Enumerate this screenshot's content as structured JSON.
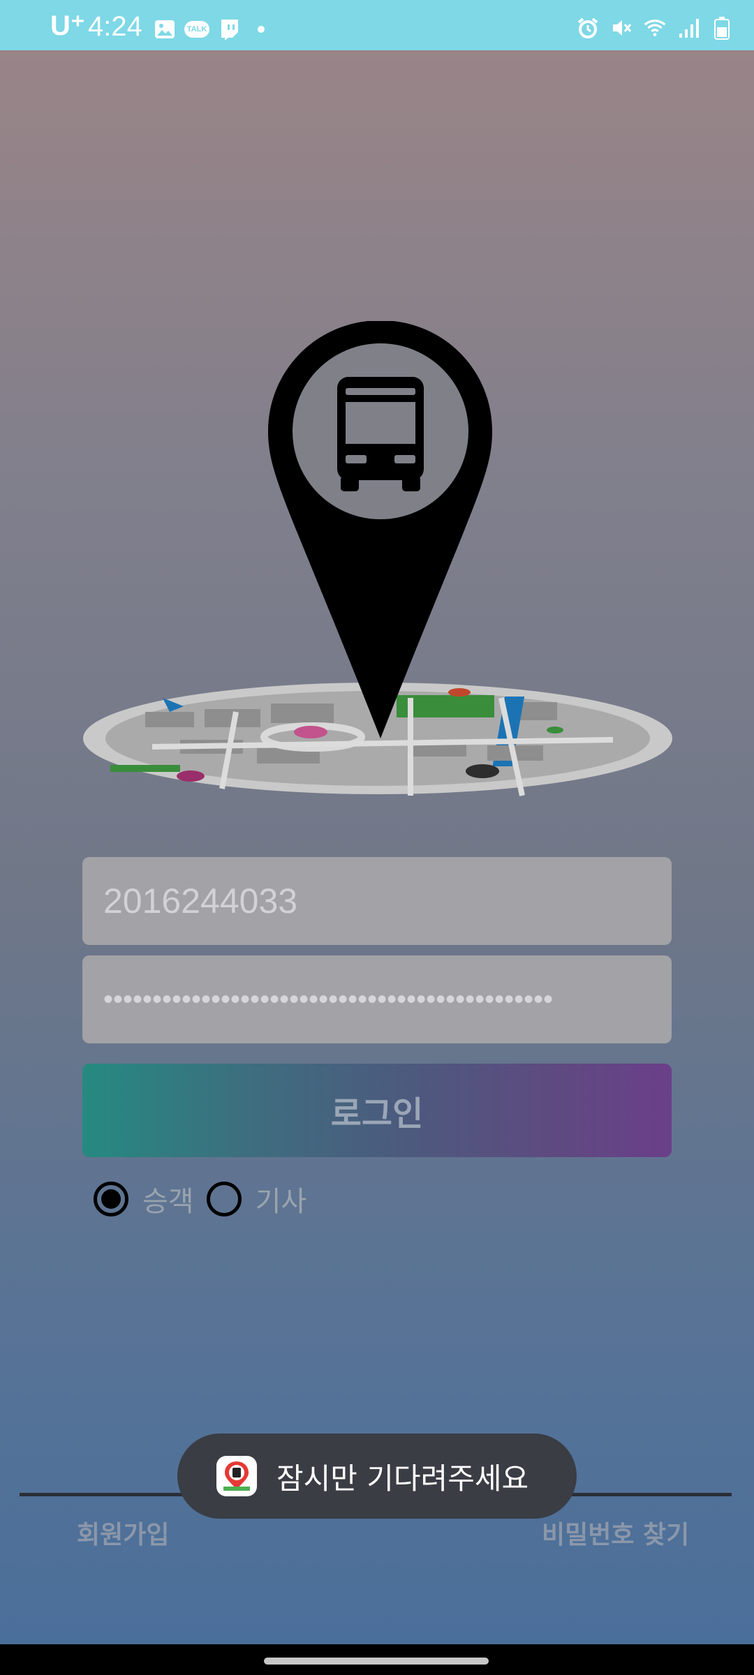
{
  "status_bar": {
    "carrier": "U⁺",
    "time": "4:24",
    "left_icons": [
      "gallery-icon",
      "kakaotalk-icon",
      "twitch-icon",
      "dot-icon"
    ],
    "kakaotalk_badge": "TALK",
    "right_icons": [
      "alarm-icon",
      "mute-icon",
      "wifi-icon",
      "signal-icon",
      "battery-icon"
    ]
  },
  "login": {
    "id_value": "2016244033",
    "password_mask": "••••••••••••••••••••••••••••••••••••••••••••••",
    "login_label": "로그인"
  },
  "user_type": {
    "options": [
      {
        "label": "승객",
        "selected": true
      },
      {
        "label": "기사",
        "selected": false
      }
    ]
  },
  "footer": {
    "signup_label": "회원가입",
    "find_password_label": "비밀번호 찾기"
  },
  "toast": {
    "message": "잠시만 기다려주세요"
  },
  "colors": {
    "status_bar": "#7ed8e6",
    "login_gradient_start": "#258a80",
    "login_gradient_end": "#6b3f8a"
  }
}
